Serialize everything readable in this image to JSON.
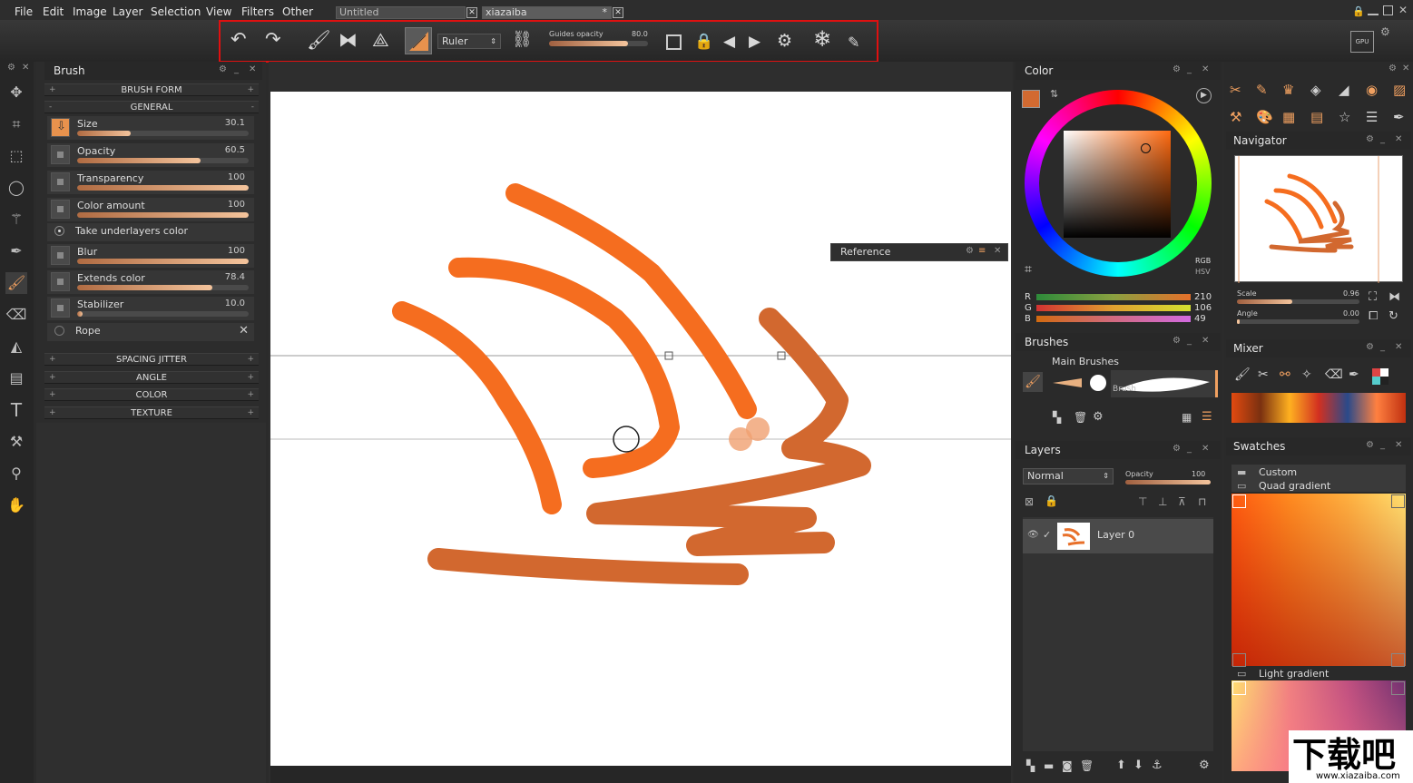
{
  "menu": [
    "File",
    "Edit",
    "Image",
    "Layer",
    "Selection",
    "View",
    "Filters",
    "Other"
  ],
  "tabs": [
    {
      "label": "Untitled",
      "modified": ""
    },
    {
      "label": "xiazaiba",
      "modified": "*"
    }
  ],
  "toolbar": {
    "ruler_select": "Ruler",
    "guides_label": "Guides opacity",
    "guides_value": "80.0",
    "guides_fraction": 0.8
  },
  "brush_panel": {
    "title": "Brush",
    "sections_top": [
      "BRUSH FORM",
      "GENERAL"
    ],
    "params": [
      {
        "label": "Size",
        "value": "30.1",
        "fraction": 0.31
      },
      {
        "label": "Opacity",
        "value": "60.5",
        "fraction": 0.72
      },
      {
        "label": "Transparency",
        "value": "100",
        "fraction": 1.0
      },
      {
        "label": "Color amount",
        "value": "100",
        "fraction": 1.0
      }
    ],
    "take_underlayers": "Take underlayers color",
    "params2": [
      {
        "label": "Blur",
        "value": "100",
        "fraction": 1.0
      },
      {
        "label": "Extends color",
        "value": "78.4",
        "fraction": 0.79
      },
      {
        "label": "Stabilizer",
        "value": "10.0",
        "fraction": 0.03
      }
    ],
    "rope": "Rope",
    "sections_bottom": [
      "SPACING JITTER",
      "ANGLE",
      "COLOR",
      "TEXTURE"
    ]
  },
  "reference_panel": {
    "title": "Reference"
  },
  "color_panel": {
    "title": "Color",
    "mode_rgb": "RGB",
    "mode_hsv": "HSV",
    "channels": [
      {
        "name": "R",
        "value": "210"
      },
      {
        "name": "G",
        "value": "106"
      },
      {
        "name": "B",
        "value": "49"
      }
    ],
    "current_color": "#d26a31"
  },
  "brushes_panel": {
    "title": "Brushes",
    "group": "Main Brushes",
    "brush_label": "Brush"
  },
  "layers_panel": {
    "title": "Layers",
    "blend_mode": "Normal",
    "opacity_label": "Opacity",
    "opacity_value": "100",
    "layer_name": "Layer 0"
  },
  "navigator": {
    "title": "Navigator",
    "scale_label": "Scale",
    "scale_value": "0.96",
    "angle_label": "Angle",
    "angle_value": "0.00"
  },
  "mixer": {
    "title": "Mixer"
  },
  "swatches": {
    "title": "Swatches",
    "custom": "Custom",
    "quad": "Quad gradient",
    "light": "Light gradient"
  },
  "watermark": {
    "url": "www.xiazaiba.com"
  }
}
